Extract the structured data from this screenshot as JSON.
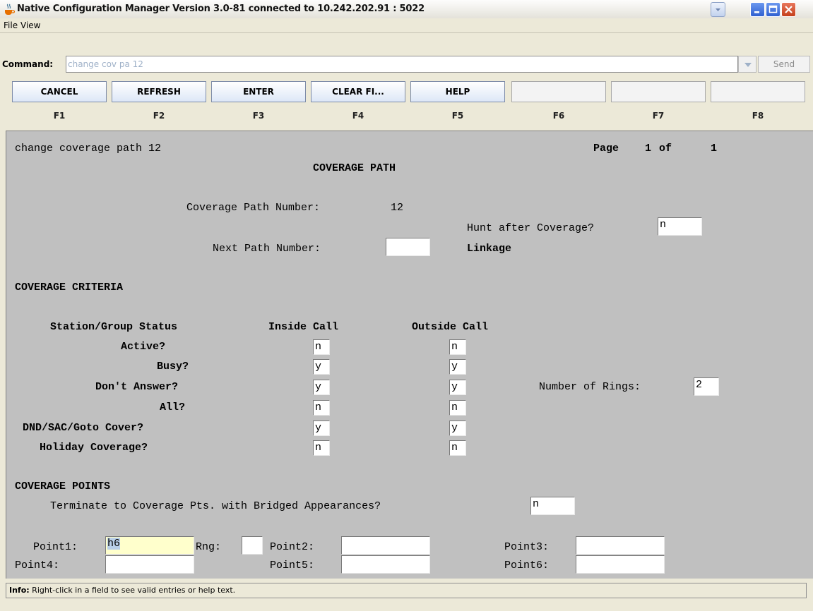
{
  "window": {
    "title": "Native Configuration Manager Version 3.0-81 connected to 10.242.202.91 : 5022"
  },
  "menu": [
    "File",
    "View"
  ],
  "command": {
    "label": "Command:",
    "value": "change cov pa 12",
    "send_label": "Send"
  },
  "fkeys": [
    {
      "button": "CANCEL",
      "key": "F1"
    },
    {
      "button": "REFRESH",
      "key": "F2"
    },
    {
      "button": "ENTER",
      "key": "F3"
    },
    {
      "button": "CLEAR FI...",
      "key": "F4"
    },
    {
      "button": "HELP",
      "key": "F5"
    },
    {
      "button": "",
      "key": "F6"
    },
    {
      "button": "",
      "key": "F7"
    },
    {
      "button": "",
      "key": "F8"
    }
  ],
  "form": {
    "command_echo": "change coverage path 12",
    "page_label": "Page",
    "page_num": "1",
    "page_of": "of",
    "page_total": "1",
    "heading": "COVERAGE PATH",
    "cov_path_label": "Coverage Path Number:",
    "cov_path_value": "12",
    "hunt_label": "Hunt after Coverage?",
    "hunt_value": "n",
    "next_path_label": "Next Path Number:",
    "next_path_value": "",
    "linkage_label": "Linkage",
    "criteria_heading": "COVERAGE CRITERIA",
    "col_status": "Station/Group Status",
    "col_inside": "Inside Call",
    "col_outside": "Outside Call",
    "criteria": [
      {
        "label": "Active?",
        "inside": "n",
        "outside": "n"
      },
      {
        "label": "Busy?",
        "inside": "y",
        "outside": "y"
      },
      {
        "label": "Don't Answer?",
        "inside": "y",
        "outside": "y"
      },
      {
        "label": "All?",
        "inside": "n",
        "outside": "n"
      },
      {
        "label": "DND/SAC/Goto Cover?",
        "inside": "y",
        "outside": "y"
      },
      {
        "label": "Holiday Coverage?",
        "inside": "n",
        "outside": "n"
      }
    ],
    "rings_label": "Number of Rings:",
    "rings_value": "2",
    "points_heading": "COVERAGE POINTS",
    "terminate_label": "Terminate to Coverage Pts. with Bridged Appearances?",
    "terminate_value": "n",
    "point1_label": "Point1:",
    "point1_value": "h6",
    "rng_label": "Rng:",
    "rng_value": "",
    "point2_label": "Point2:",
    "point2_value": "",
    "point3_label": "Point3:",
    "point3_value": "",
    "point4_label": "Point4:",
    "point4_value": "",
    "point5_label": "Point5:",
    "point5_value": "",
    "point6_label": "Point6:",
    "point6_value": ""
  },
  "info": {
    "label": "Info:",
    "text": "Right-click in a field to see valid entries or help text."
  }
}
